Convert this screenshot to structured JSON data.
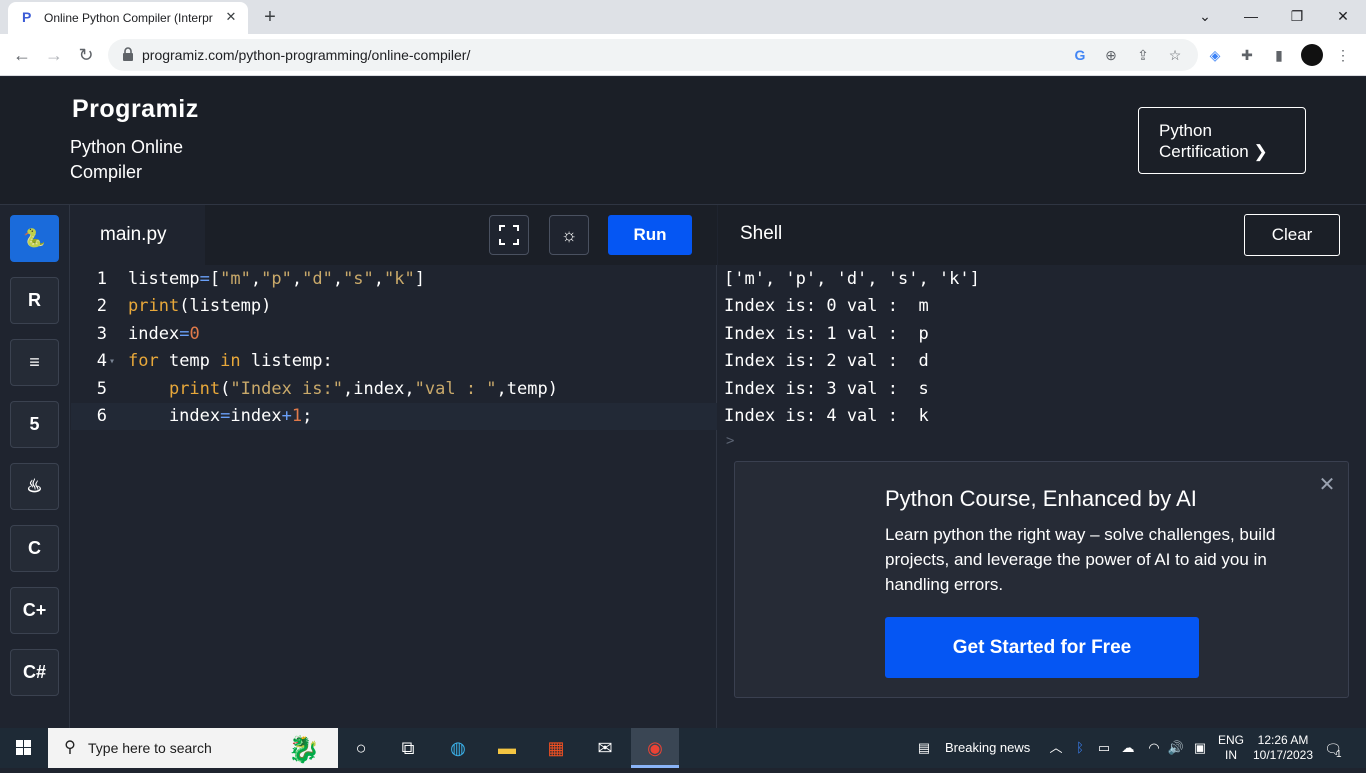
{
  "browser": {
    "tab_title": "Online Python Compiler (Interpr",
    "tab_close": "✕",
    "new_tab": "+",
    "url": "programiz.com/python-programming/online-compiler/",
    "window_controls": {
      "tabsearch": "⌄",
      "minimize": "—",
      "restore": "❐",
      "close": "✕"
    }
  },
  "site": {
    "logo": "Programiz",
    "title": "Python Online Compiler",
    "cert_button": "Python Certification ❯"
  },
  "sidebar": {
    "languages": [
      {
        "name": "python-icon",
        "glyph": "🐍",
        "active": true
      },
      {
        "name": "r-icon",
        "glyph": "R",
        "active": false
      },
      {
        "name": "sql-icon",
        "glyph": "≡",
        "active": false
      },
      {
        "name": "html5-icon",
        "glyph": "5",
        "active": false
      },
      {
        "name": "java-icon",
        "glyph": "♨",
        "active": false
      },
      {
        "name": "c-icon",
        "glyph": "C",
        "active": false
      },
      {
        "name": "cpp-icon",
        "glyph": "C+",
        "active": false
      },
      {
        "name": "csharp-icon",
        "glyph": "C#",
        "active": false
      }
    ]
  },
  "editor": {
    "file_name": "main.py",
    "run_label": "Run",
    "lines": [
      {
        "n": "1",
        "tokens": [
          [
            "id",
            "listemp"
          ],
          [
            "op",
            "="
          ],
          [
            "pn",
            "["
          ],
          [
            "str",
            "\"m\""
          ],
          [
            "pn",
            ","
          ],
          [
            "str",
            "\"p\""
          ],
          [
            "pn",
            ","
          ],
          [
            "str",
            "\"d\""
          ],
          [
            "pn",
            ","
          ],
          [
            "str",
            "\"s\""
          ],
          [
            "pn",
            ","
          ],
          [
            "str",
            "\"k\""
          ],
          [
            "pn",
            "]"
          ]
        ]
      },
      {
        "n": "2",
        "tokens": [
          [
            "fn",
            "print"
          ],
          [
            "pn",
            "(listemp)"
          ]
        ]
      },
      {
        "n": "3",
        "tokens": [
          [
            "id",
            "index"
          ],
          [
            "op",
            "="
          ],
          [
            "num",
            "0"
          ]
        ]
      },
      {
        "n": "4",
        "tokens": [
          [
            "kw",
            "for"
          ],
          [
            "id",
            " temp "
          ],
          [
            "kw",
            "in"
          ],
          [
            "id",
            " listemp:"
          ]
        ]
      },
      {
        "n": "5",
        "tokens": [
          [
            "id",
            "    "
          ],
          [
            "fn",
            "print"
          ],
          [
            "pn",
            "("
          ],
          [
            "str",
            "\"Index is:\""
          ],
          [
            "pn",
            ",index,"
          ],
          [
            "str",
            "\"val : \""
          ],
          [
            "pn",
            ",temp)"
          ]
        ]
      },
      {
        "n": "6",
        "tokens": [
          [
            "id",
            "    index"
          ],
          [
            "op",
            "="
          ],
          [
            "id",
            "index"
          ],
          [
            "op",
            "+"
          ],
          [
            "num",
            "1"
          ],
          [
            "pn",
            ";"
          ]
        ]
      }
    ]
  },
  "shell": {
    "title": "Shell",
    "clear_label": "Clear",
    "output": [
      "['m', 'p', 'd', 's', 'k']",
      "Index is: 0 val :  m",
      "Index is: 1 val :  p",
      "Index is: 2 val :  d",
      "Index is: 3 val :  s",
      "Index is: 4 val :  k"
    ],
    "prompt": ">"
  },
  "ad": {
    "title": "Python Course, Enhanced by AI",
    "body": "Learn python the right way – solve challenges, build projects, and leverage the power of AI to aid you in handling errors.",
    "cta": "Get Started for Free",
    "close": "✕"
  },
  "taskbar": {
    "search_placeholder": "Type here to search",
    "news": "Breaking news",
    "lang_line1": "ENG",
    "lang_line2": "IN",
    "time": "12:26 AM",
    "date": "10/17/2023",
    "notifications": "1"
  },
  "colors": {
    "accent": "#0556f3",
    "bg": "#1f242f",
    "header": "#1b1f27"
  }
}
